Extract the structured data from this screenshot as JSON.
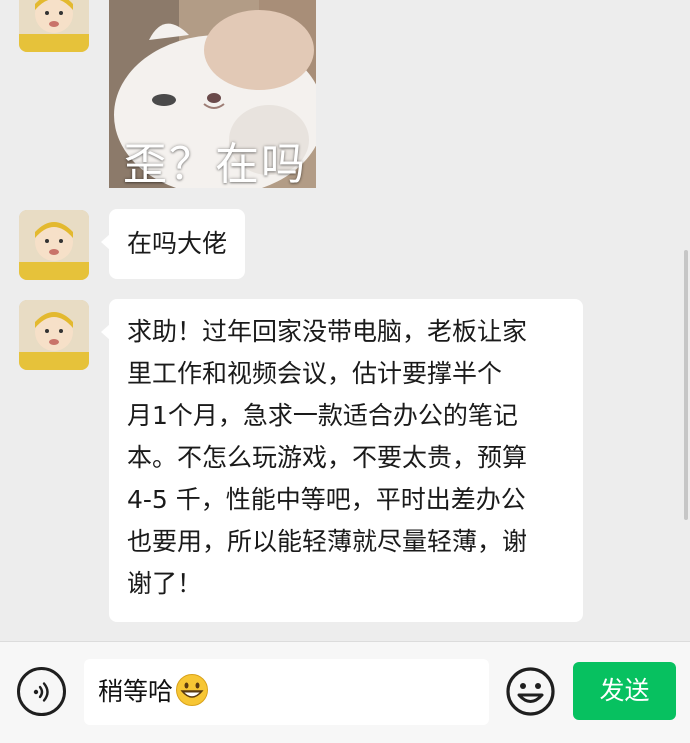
{
  "colors": {
    "background": "#ededed",
    "bubble": "#ffffff",
    "send_button": "#07c160",
    "input_bar": "#f7f7f7"
  },
  "messages": [
    {
      "type": "sticker",
      "caption": "歪？在吗",
      "icon": "cat-sticker-image"
    },
    {
      "type": "text",
      "text": "在吗大佬"
    },
    {
      "type": "text",
      "lines": [
        "求助！过年回家没带电脑，老板让家",
        "里工作和视频会议，估计要撑半个",
        "月1个月，急求一款适合办公的笔记",
        "本。不怎么玩游戏，不要太贵，预算",
        "4-5 千，性能中等吧，平时出差办公",
        "也要用，所以能轻薄就尽量轻薄，谢",
        "谢了！"
      ]
    }
  ],
  "input_bar": {
    "voice_icon": "voice-icon",
    "draft_text": "稍等哈",
    "draft_emoji": "grinning-face-emoji",
    "emoji_icon": "emoji-icon",
    "send_label": "发送"
  }
}
